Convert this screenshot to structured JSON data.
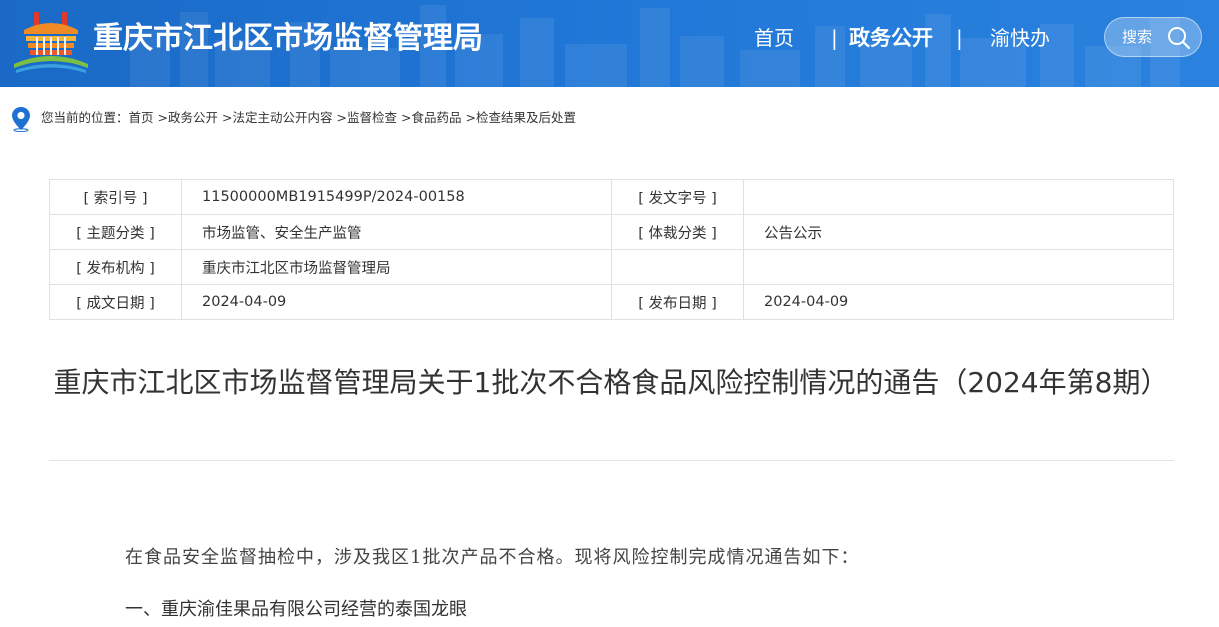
{
  "header": {
    "site_title": "重庆市江北区市场监督管理局",
    "nav": {
      "home": "首页",
      "sep": "|",
      "gov_open": "政务公开",
      "yu_kuai_ban": "渝快办"
    },
    "search_label": "搜索",
    "colors": {
      "bar": "#1f72d2",
      "emblem_orange": "#f08a24",
      "emblem_red": "#e03a2c"
    }
  },
  "breadcrumb": {
    "prefix": "您当前的位置：",
    "items": [
      "首页",
      "政务公开",
      "法定主动公开内容",
      "监督检查",
      "食品药品",
      "检查结果及后处置"
    ],
    "separator": ">"
  },
  "meta_table": {
    "rows": [
      {
        "label1": "[ 索引号 ]",
        "value1": "11500000MB1915499P/2024-00158",
        "label2": "[ 发文字号 ]",
        "value2": ""
      },
      {
        "label1": "[ 主题分类 ]",
        "value1": "市场监管、安全生产监管",
        "label2": "[ 体裁分类 ]",
        "value2": "公告公示"
      },
      {
        "label1": "[ 发布机构 ]",
        "value1": "重庆市江北区市场监督管理局",
        "label2": "",
        "value2": ""
      },
      {
        "label1": "[ 成文日期 ]",
        "value1": "2024-04-09",
        "label2": "[ 发布日期 ]",
        "value2": "2024-04-09"
      }
    ]
  },
  "document": {
    "title": "重庆市江北区市场监督管理局关于1批次不合格食品风险控制情况的通告（2024年第8期）",
    "intro": "在食品安全监督抽检中，涉及我区1批次产品不合格。现将风险控制完成情况通告如下：",
    "section1": "一、重庆渝佳果品有限公司经营的泰国龙眼"
  }
}
